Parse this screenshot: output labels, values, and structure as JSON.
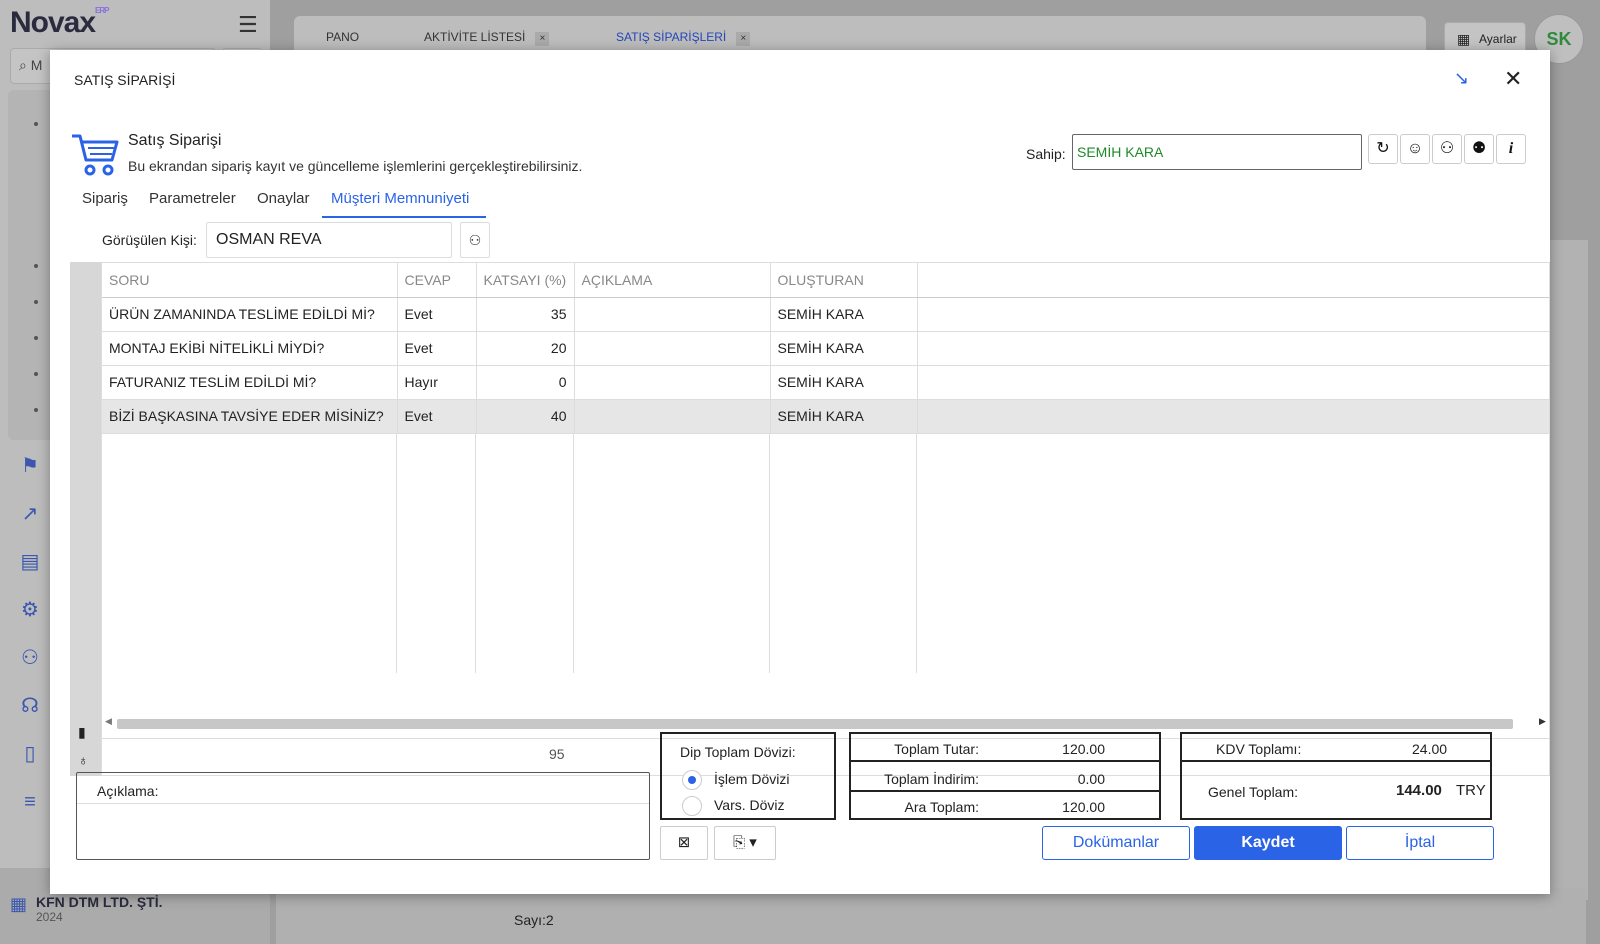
{
  "background": {
    "logo": "Novax",
    "logo_badge": "ERP",
    "search_placeholder": "M",
    "tabs": [
      {
        "label": "PANO"
      },
      {
        "label": "AKTİVİTE LİSTESİ",
        "close": "×"
      },
      {
        "label": "SATIŞ SİPARİŞLERİ",
        "close": "×"
      }
    ],
    "settings_label": "Ayarlar",
    "avatar_initials": "SK",
    "company_name": "KFN DTM LTD. ŞTİ.",
    "company_year": "2024",
    "count_label": "Sayı:2"
  },
  "modal": {
    "title": "SATIŞ SİPARİŞİ",
    "minimize_icon": "arrow-down-right-icon",
    "close_icon": "close-icon",
    "header": {
      "title": "Satış Siparişi",
      "subtitle": "Bu ekrandan sipariş kayıt ve güncelleme işlemlerini gerçekleştirebilirsiniz."
    },
    "owner": {
      "label": "Sahip:",
      "value": "SEMİH KARA"
    },
    "tabs": [
      {
        "label": "Sipariş"
      },
      {
        "label": "Parametreler"
      },
      {
        "label": "Onaylar"
      },
      {
        "label": "Müşteri Memnuniyeti",
        "active": true
      }
    ],
    "person": {
      "label": "Görüşülen Kişi:",
      "value": "OSMAN REVA"
    },
    "grid": {
      "columns": [
        "SORU",
        "CEVAP",
        "KATSAYI (%)",
        "AÇIKLAMA",
        "OLUŞTURAN"
      ],
      "rows": [
        {
          "soru": "ÜRÜN ZAMANINDA TESLİME EDİLDİ Mİ?",
          "cevap": "Evet",
          "katsayi": "35",
          "aciklama": "",
          "olusturan": "SEMİH KARA"
        },
        {
          "soru": "MONTAJ EKİBİ NİTELİKLİ MİYDİ?",
          "cevap": "Evet",
          "katsayi": "20",
          "aciklama": "",
          "olusturan": "SEMİH KARA"
        },
        {
          "soru": "FATURANIZ TESLİM EDİLDİ Mİ?",
          "cevap": "Hayır",
          "katsayi": "0",
          "aciklama": "",
          "olusturan": "SEMİH KARA"
        },
        {
          "soru": "BİZİ BAŞKASINA TAVSİYE EDER MİSİNİZ?",
          "cevap": "Evet",
          "katsayi": "40",
          "aciklama": "",
          "olusturan": "SEMİH KARA"
        }
      ],
      "total": "95"
    },
    "note_label": "Açıklama:",
    "currency": {
      "label": "Dip Toplam Dövizi:",
      "options": [
        "İşlem Dövizi",
        "Vars. Döviz"
      ],
      "selected": "İşlem Dövizi"
    },
    "totals": {
      "toplam_tutar_label": "Toplam Tutar:",
      "toplam_tutar": "120.00",
      "toplam_indirim_label": "Toplam İndirim:",
      "toplam_indirim": "0.00",
      "ara_toplam_label": "Ara Toplam:",
      "ara_toplam": "120.00",
      "kdv_label": "KDV Toplamı:",
      "kdv": "24.00",
      "genel_label": "Genel Toplam:",
      "genel": "144.00",
      "currency": "TRY"
    },
    "buttons": {
      "documents": "Dokümanlar",
      "save": "Kaydet",
      "cancel": "İptal"
    },
    "colors": {
      "accent": "#2a63e6",
      "owner_text": "#1e8a28"
    }
  }
}
